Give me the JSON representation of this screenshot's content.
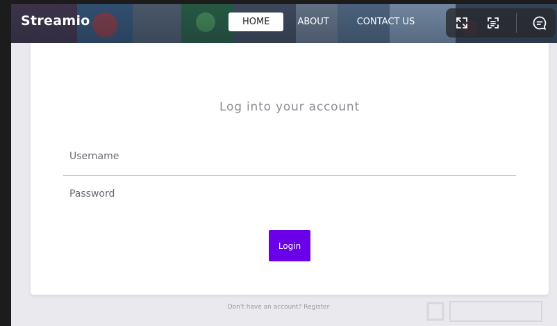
{
  "header": {
    "brand": "Streamio",
    "nav": [
      {
        "label": "HOME",
        "active": true
      },
      {
        "label": "ABOUT",
        "active": false
      },
      {
        "label": "CONTACT US",
        "active": false
      }
    ],
    "toolbar_icons": [
      "expand-icon",
      "text-recognition-icon",
      "chat-icon"
    ]
  },
  "login": {
    "title": "Log into your account",
    "username_placeholder": "Username",
    "password_placeholder": "Password",
    "login_label": "Login"
  },
  "footer": {
    "text": "Don't have an account? Register"
  },
  "colors": {
    "accent": "#6a00e8",
    "page_bg": "#e9e9ee",
    "card_bg": "#ffffff"
  }
}
